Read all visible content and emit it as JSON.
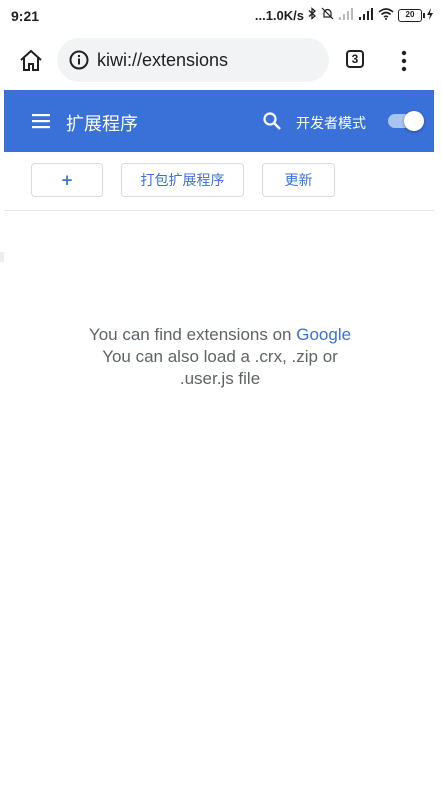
{
  "status_bar": {
    "time": "9:21",
    "network_speed": "...1.0K/s",
    "battery": "20"
  },
  "browser": {
    "url": "kiwi://extensions",
    "tab_count": "3"
  },
  "header": {
    "title": "扩展程序",
    "developer_mode_label": "开发者模式",
    "developer_mode_on": true,
    "accent": "#3a71d8"
  },
  "buttons": {
    "add": "+",
    "pack": "打包扩展程序",
    "update": "更新"
  },
  "empty_state": {
    "line1_prefix": "You can find extensions on ",
    "line1_link": "Google",
    "line2": "You can also load a .crx, .zip or",
    "line3": ".user.js file"
  }
}
